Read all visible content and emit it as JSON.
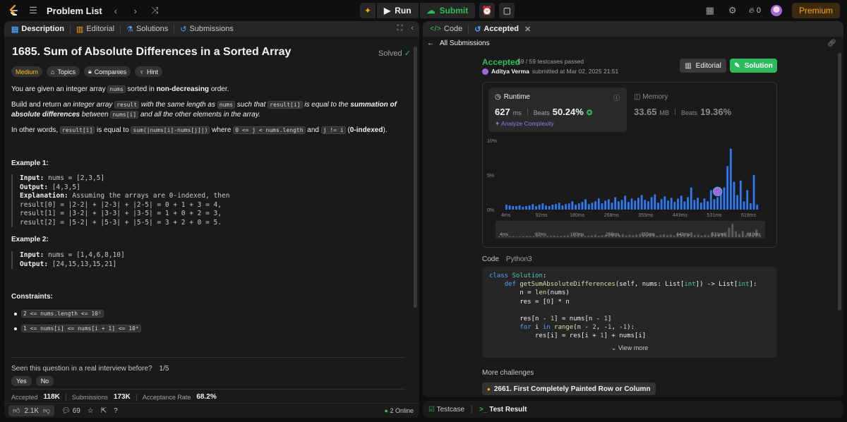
{
  "topbar": {
    "problem_list": "Problem List",
    "run": "Run",
    "submit": "Submit",
    "fire_count": "0",
    "premium": "Premium"
  },
  "left": {
    "tabs": [
      "Description",
      "Editorial",
      "Solutions",
      "Submissions"
    ],
    "title": "1685. Sum of Absolute Differences in a Sorted Array",
    "solved": "Solved",
    "chips": [
      "Medium",
      "Topics",
      "Companies",
      "Hint"
    ],
    "p1": {
      "a": "You are given an integer array ",
      "code": "nums",
      "b": " sorted in ",
      "strong": "non-decreasing",
      "c": " order."
    },
    "p2": {
      "a": "Build and return ",
      "b": "an integer array ",
      "code1": "result",
      "c": " with the same length as ",
      "code2": "nums",
      "d": " such that ",
      "code3": "result[i]",
      "e": " is equal to the ",
      "strong": "summation of absolute differences",
      "f": " between ",
      "code4": "nums[i]",
      "g": " and all the other elements in the array."
    },
    "p3": {
      "a": "In other words, ",
      "code1": "result[i]",
      "b": " is equal to ",
      "code2": "sum(|nums[i]-nums[j]|)",
      "c": " where ",
      "code3": "0 <= j < nums.length",
      "d": " and ",
      "code4": "j != i",
      "e": " (",
      "strong": "0-indexed",
      "f": ")."
    },
    "example1_title": "Example 1:",
    "example1": {
      "input_label": "Input:",
      "input": " nums = [2,3,5]",
      "output_label": "Output:",
      "output": " [4,3,5]",
      "expl_label": "Explanation:",
      "expl": " Assuming the arrays are 0-indexed, then",
      "lines": [
        "result[0] = |2-2| + |2-3| + |2-5| = 0 + 1 + 3 = 4,",
        "result[1] = |3-2| + |3-3| + |3-5| = 1 + 0 + 2 = 3,",
        "result[2] = |5-2| + |5-3| + |5-5| = 3 + 2 + 0 = 5."
      ]
    },
    "example2_title": "Example 2:",
    "example2": {
      "input_label": "Input:",
      "input": " nums = [1,4,6,8,10]",
      "output_label": "Output:",
      "output": " [24,15,13,15,21]"
    },
    "constraints_title": "Constraints:",
    "constraints": [
      "2 <= nums.length <= 10⁵",
      "1 <= nums[i] <= nums[i + 1] <= 10⁴"
    ],
    "seen_question": "Seen this question in a real interview before?",
    "seen_page": "1/5",
    "yes": "Yes",
    "no": "No",
    "stats": {
      "accepted_label": "Accepted",
      "accepted": "118K",
      "subs_label": "Submissions",
      "subs": "173K",
      "rate_label": "Acceptance Rate",
      "rate": "68.2%"
    },
    "likes": "2.1K",
    "comments": "69",
    "online": "2 Online"
  },
  "right": {
    "tabs": [
      "Code",
      "Accepted"
    ],
    "all_submissions": "All Submissions",
    "status": "Accepted",
    "testcases": "59 / 59 testcases passed",
    "user": "Aditya Verma",
    "submitted_at": "submitted at Mar 02, 2025 21:51",
    "editorial_btn": "Editorial",
    "solution_btn": "Solution",
    "runtime_label": "Runtime",
    "runtime_value": "627",
    "runtime_unit": "ms",
    "beats_label": "Beats",
    "runtime_beats": "50.24%",
    "analyze": "Analyze Complexity",
    "memory_label": "Memory",
    "memory_value": "33.65",
    "memory_unit": "MB",
    "memory_beats": "19.36%",
    "code_label": "Code",
    "lang": "Python3",
    "view_more": "View more",
    "more_challenges": "More challenges",
    "challenge": "2661. First Completely Painted Row or Column",
    "bottom_tabs": [
      "Testcase",
      "Test Result"
    ]
  },
  "chart_data": {
    "type": "bar",
    "ylabel_ticks": [
      "10%",
      "5%",
      "0%"
    ],
    "ylim": [
      0,
      10
    ],
    "x_tick_labels": [
      "4ms",
      "92ms",
      "180ms",
      "268ms",
      "355ms",
      "443ms",
      "531ms",
      "619ms"
    ],
    "values": [
      0.7,
      0.6,
      0.5,
      0.5,
      0.6,
      0.4,
      0.5,
      0.6,
      0.8,
      0.5,
      0.7,
      0.9,
      0.6,
      0.5,
      0.7,
      0.8,
      1.0,
      0.6,
      0.8,
      0.9,
      1.2,
      0.7,
      0.9,
      1.1,
      1.5,
      0.8,
      1.0,
      1.2,
      1.6,
      0.9,
      1.3,
      1.5,
      1.0,
      1.8,
      1.2,
      1.4,
      2.0,
      1.1,
      1.6,
      1.3,
      1.7,
      2.1,
      1.4,
      1.2,
      1.8,
      2.2,
      1.0,
      1.5,
      1.9,
      1.3,
      1.7,
      1.1,
      1.6,
      2.0,
      1.2,
      1.8,
      3.2,
      1.4,
      1.7,
      1.0,
      1.6,
      1.2,
      2.8,
      1.5,
      1.8,
      2.6,
      3.2,
      6.3,
      8.8,
      4.0,
      2.1,
      4.2,
      1.2,
      2.8,
      0.9,
      5.0,
      0.7
    ],
    "highlight_index": 64
  }
}
